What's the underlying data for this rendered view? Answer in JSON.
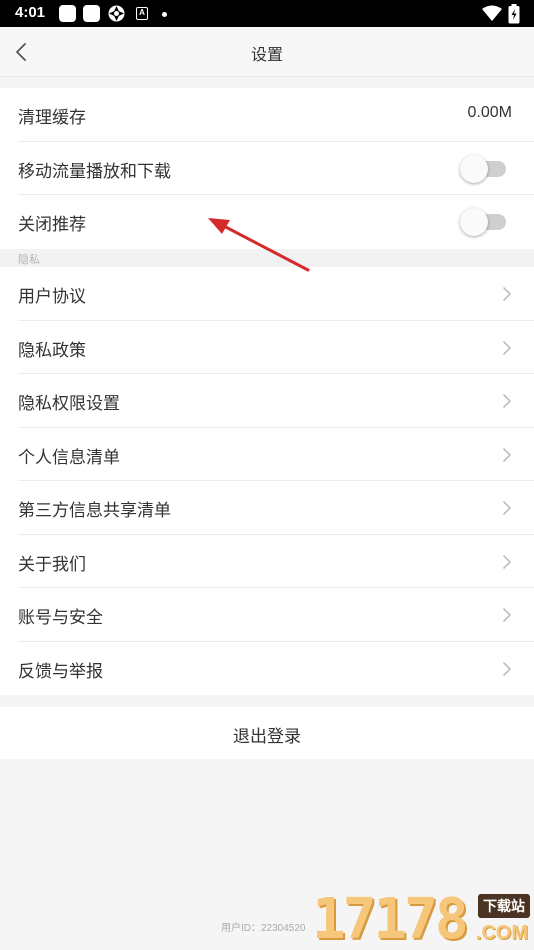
{
  "status_bar": {
    "time": "4:01",
    "icons": [
      "notification-square-icon",
      "notification-square-icon",
      "app-icon",
      "a-icon",
      "dot-icon",
      "wifi-icon",
      "battery-charging-icon"
    ],
    "a_icon_letter": "A"
  },
  "nav": {
    "title": "设置",
    "back_icon": "chevron-left-icon"
  },
  "general": {
    "clear_cache": {
      "label": "清理缓存",
      "value": "0.00M"
    },
    "mobile_data": {
      "label": "移动流量播放和下载",
      "enabled": false
    },
    "close_recommend": {
      "label": "关闭推荐",
      "enabled": false
    }
  },
  "privacy": {
    "header": "隐私",
    "items": [
      {
        "label": "用户协议"
      },
      {
        "label": "隐私政策"
      },
      {
        "label": "隐私权限设置"
      },
      {
        "label": "个人信息清单"
      },
      {
        "label": "第三方信息共享清单"
      },
      {
        "label": "关于我们"
      },
      {
        "label": "账号与安全"
      },
      {
        "label": "反馈与举报"
      }
    ]
  },
  "logout": {
    "label": "退出登录"
  },
  "footer": {
    "user_id": "用户ID：22304520"
  },
  "watermark": {
    "digits": "17178",
    "badge": "下载站",
    "domain": ".COM"
  },
  "colors": {
    "background": "#f5f5f5",
    "text": "#333333",
    "annotation_arrow": "#d42a2a",
    "toggle_off_track": "#cfcfcf"
  }
}
